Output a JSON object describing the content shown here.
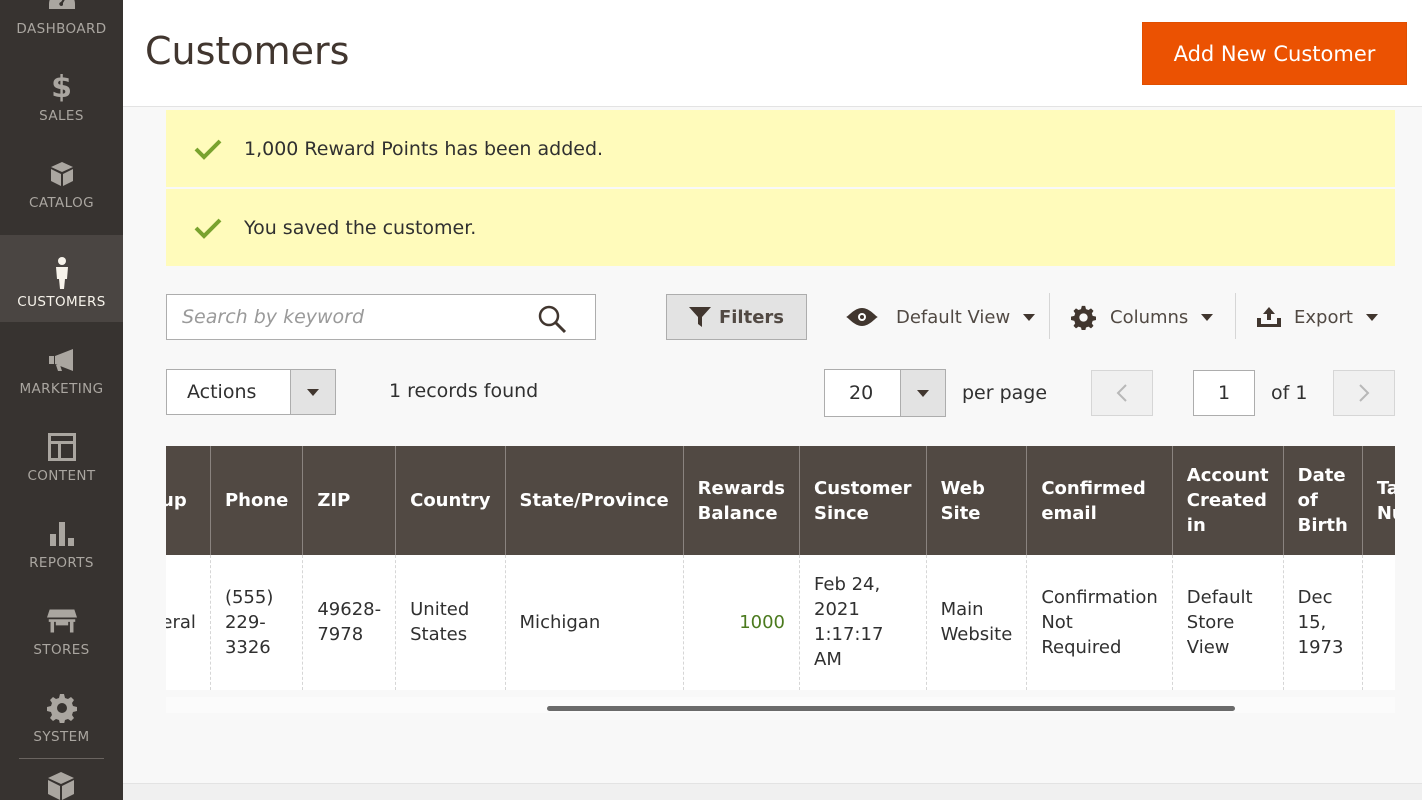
{
  "sidebar": {
    "items": [
      {
        "label": "DASHBOARD",
        "icon": "dashboard-icon"
      },
      {
        "label": "SALES",
        "icon": "dollar-icon"
      },
      {
        "label": "CATALOG",
        "icon": "box-icon"
      },
      {
        "label": "CUSTOMERS",
        "icon": "person-icon",
        "active": true
      },
      {
        "label": "MARKETING",
        "icon": "megaphone-icon"
      },
      {
        "label": "CONTENT",
        "icon": "layout-icon"
      },
      {
        "label": "REPORTS",
        "icon": "bar-chart-icon"
      },
      {
        "label": "STORES",
        "icon": "storefront-icon"
      },
      {
        "label": "SYSTEM",
        "icon": "gear-icon"
      }
    ]
  },
  "header": {
    "title": "Customers",
    "add_button": "Add New Customer"
  },
  "messages": [
    "1,000 Reward Points has been added.",
    "You saved the customer."
  ],
  "toolbar": {
    "search_placeholder": "Search by keyword",
    "filters": "Filters",
    "view": "Default View",
    "columns": "Columns",
    "export": "Export"
  },
  "listing": {
    "actions": "Actions",
    "records": "1 records found",
    "per_page_value": "20",
    "per_page_label": "per page",
    "current_page": "1",
    "of_pages": "of 1"
  },
  "grid": {
    "headers": [
      "Group",
      "Phone",
      "ZIP",
      "Country",
      "State/Province",
      "Rewards Balance",
      "Customer Since",
      "Web Site",
      "Confirmed email",
      "Account Created in",
      "Date of Birth",
      "Tax VAT Number"
    ],
    "row": [
      "General",
      "(555) 229-3326",
      "49628-7978",
      "United States",
      "Michigan",
      "1000",
      "Feb 24, 2021 1:17:17 AM",
      "Main Website",
      "Confirmation Not Required",
      "Default Store View",
      "Dec 15, 1973",
      ""
    ]
  },
  "colors": {
    "accent": "#eb5202",
    "sidebar": "#373330",
    "header_row": "#514943",
    "message_bg": "#fffbbb",
    "success_check": "#79a22e",
    "reward_value": "#4b7a1e"
  }
}
